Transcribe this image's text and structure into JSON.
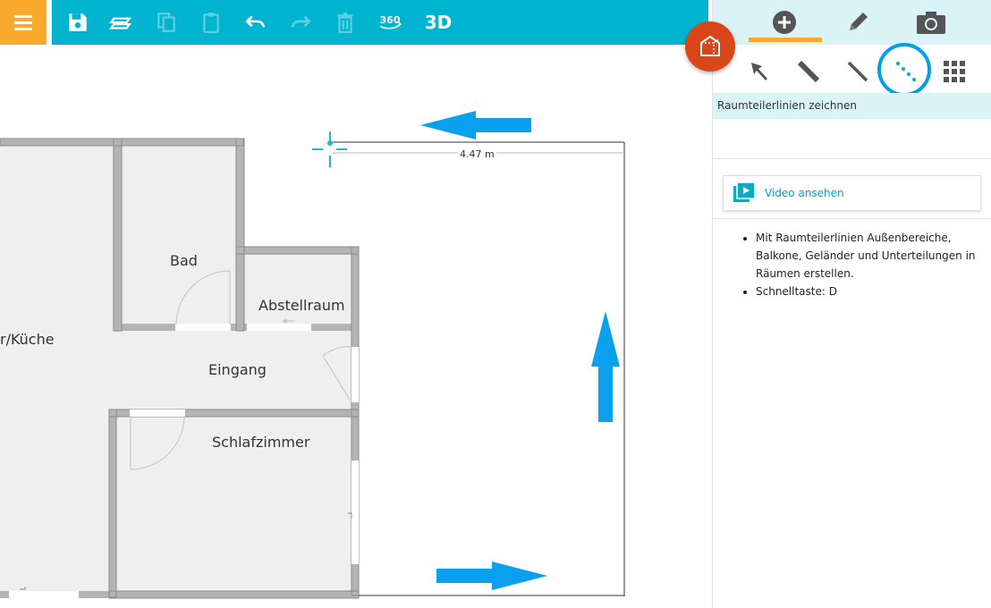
{
  "toolbar": {
    "menu": "menu-icon",
    "buttons": [
      "save-icon",
      "floors-icon",
      "copy-icon",
      "paste-icon",
      "undo-icon",
      "redo-icon",
      "delete-icon",
      "view-360-icon"
    ],
    "label_360": "360",
    "label_3d": "3D"
  },
  "colors": {
    "toolbar": "#00b4d0",
    "menu": "#f8a92e",
    "accent": "#f8a92e",
    "fab": "#d9461a",
    "highlight": "#00a0e6",
    "arrow": "#0aa0ee",
    "panel_tint": "#d9f3f7"
  },
  "panel": {
    "tabs": [
      "add-icon",
      "edit-icon",
      "camera-icon"
    ],
    "active_tab": "add-icon",
    "tools": [
      "select-arrow-icon",
      "wall-tool-icon",
      "line-tool-icon",
      "divider-line-icon",
      "grid-icon"
    ],
    "selected_tool": "divider-line-icon",
    "title": "Raumteilerlinien zeichnen",
    "video_label": "Video ansehen",
    "help": [
      "Mit Raumteilerlinien Außenbereiche, Balkone, Geländer und Unterteilungen in Räumen erstellen.",
      "Schnelltaste: D"
    ]
  },
  "floorplan": {
    "rooms": {
      "kitchen": "r/Küche",
      "bath": "Bad",
      "storage": "Abstellraum",
      "entrance": "Eingang",
      "bedroom": "Schlafzimmer"
    },
    "dimension": "4.47 m"
  }
}
